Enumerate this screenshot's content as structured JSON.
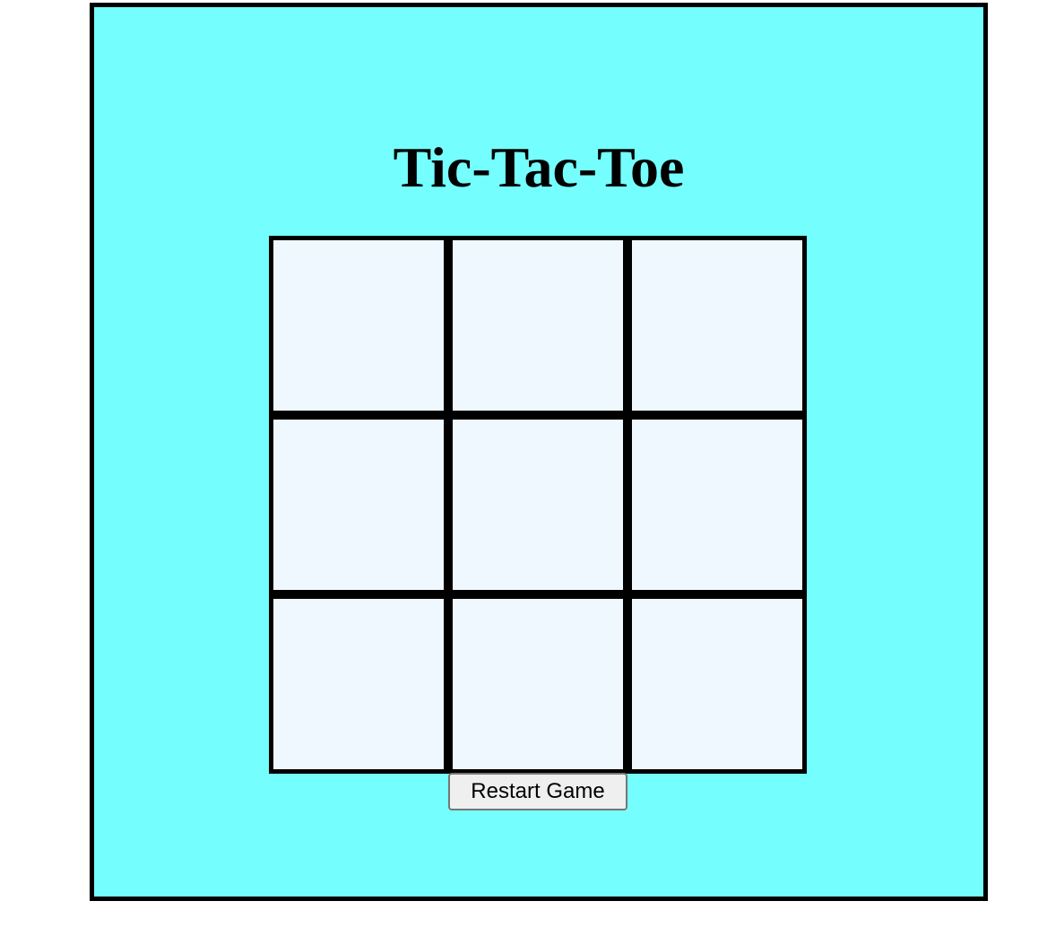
{
  "game": {
    "title": "Tic-Tac-Toe",
    "board": [
      [
        "",
        "",
        ""
      ],
      [
        "",
        "",
        ""
      ],
      [
        "",
        "",
        ""
      ]
    ],
    "restart_label": "Restart Game"
  },
  "colors": {
    "panel_background": "#75fefe",
    "cell_background": "#f0f8ff",
    "grid_lines": "#000000"
  }
}
